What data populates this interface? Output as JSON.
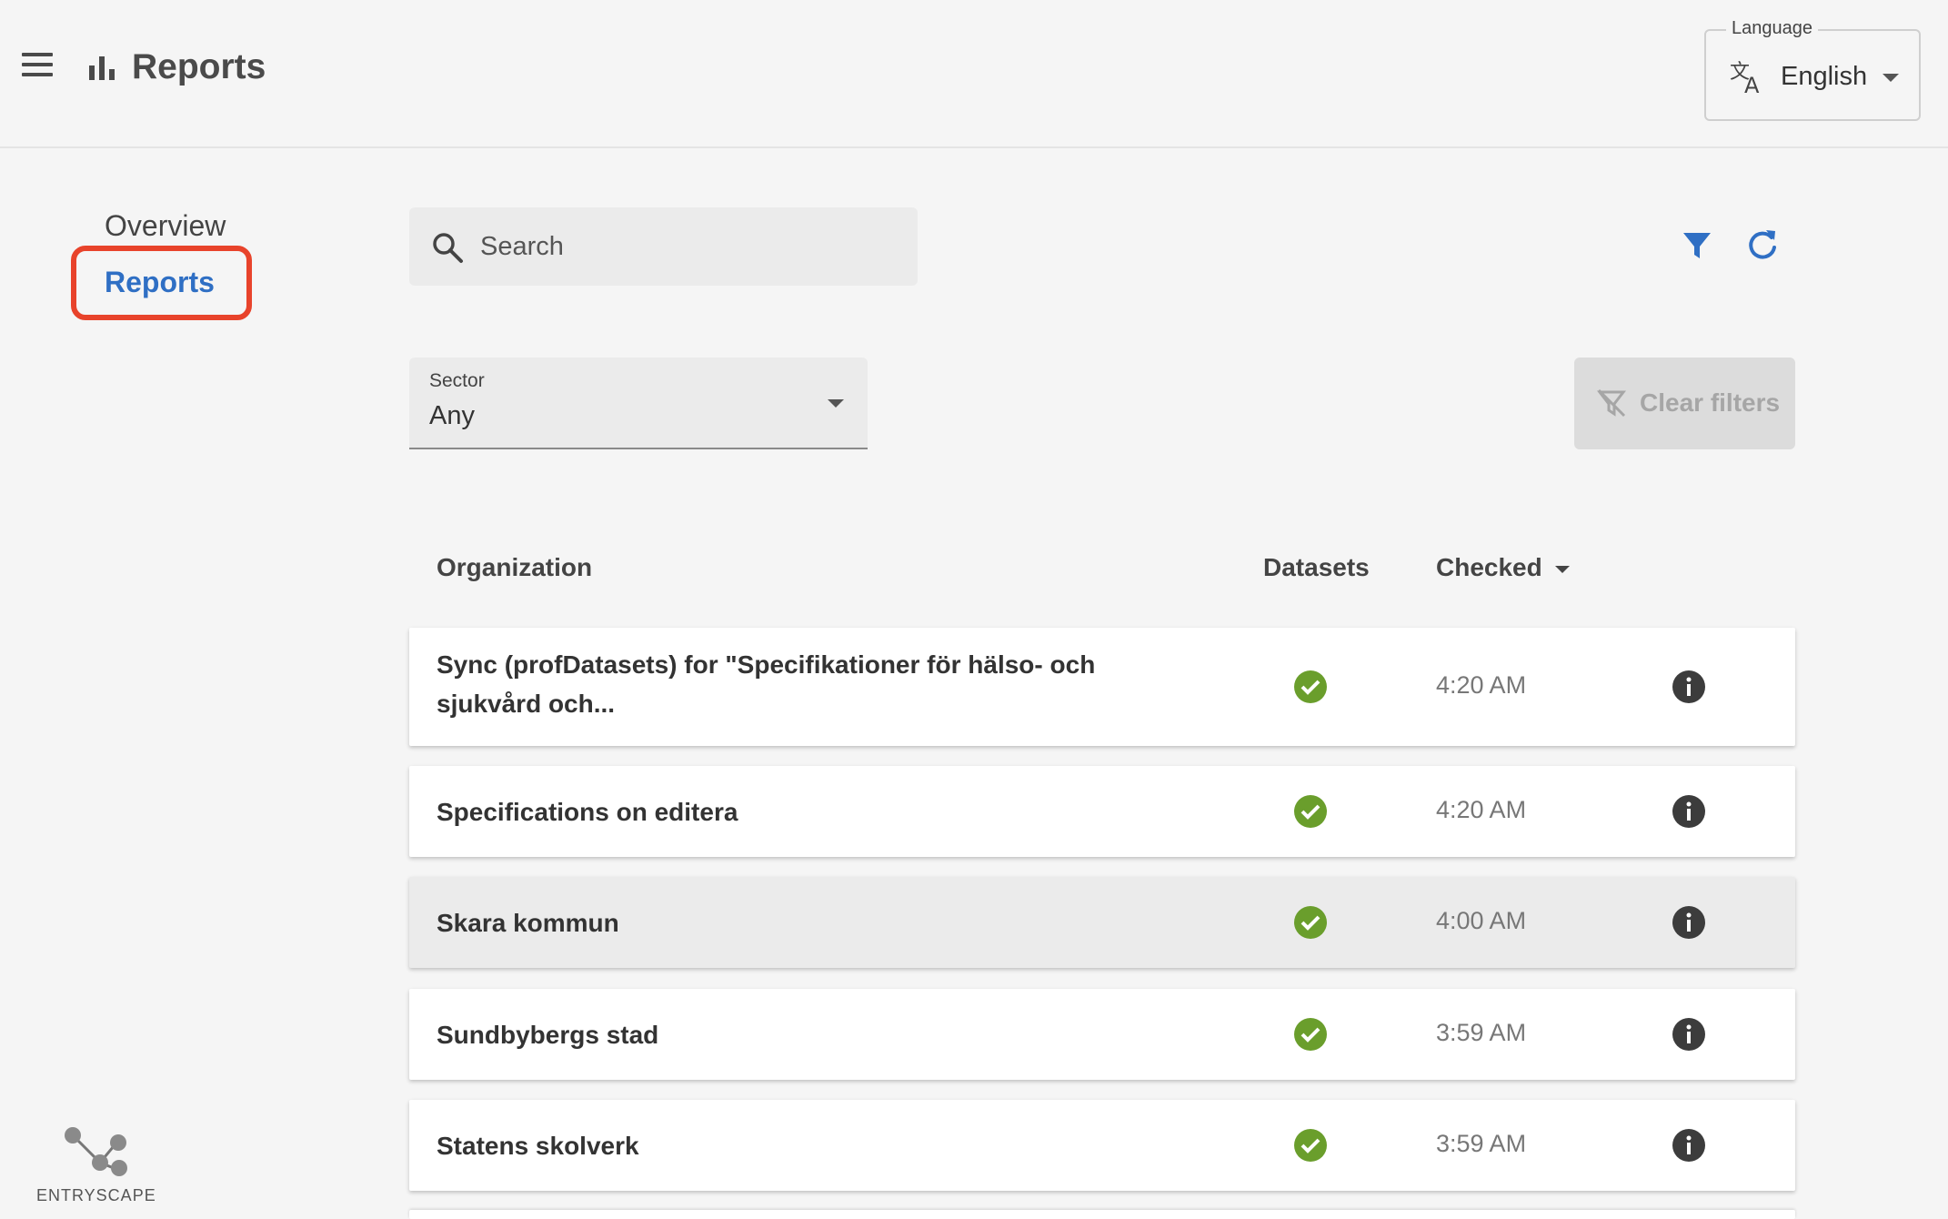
{
  "header": {
    "title": "Reports",
    "language": {
      "legend": "Language",
      "value": "English"
    }
  },
  "sidebar": {
    "items": [
      {
        "label": "Overview",
        "active": false
      },
      {
        "label": "Reports",
        "active": true
      }
    ],
    "logo_text": "ENTRYSCAPE"
  },
  "toolbar": {
    "search_placeholder": "Search",
    "filter_icon": "filter-icon",
    "refresh_icon": "refresh-icon"
  },
  "filters": {
    "sector": {
      "label": "Sector",
      "value": "Any"
    },
    "clear_label": "Clear filters"
  },
  "table": {
    "columns": {
      "organization": "Organization",
      "datasets": "Datasets",
      "checked": "Checked"
    },
    "rows": [
      {
        "name": "Sync (profDatasets) for \"Specifikationer för hälso- och sjukvård och...",
        "datasets_status": "ok",
        "checked": "4:20 AM"
      },
      {
        "name": "Specifications on editera",
        "datasets_status": "ok",
        "checked": "4:20 AM"
      },
      {
        "name": "Skara kommun",
        "datasets_status": "ok",
        "checked": "4:00 AM"
      },
      {
        "name": "Sundbybergs stad",
        "datasets_status": "ok",
        "checked": "3:59 AM"
      },
      {
        "name": "Statens skolverk",
        "datasets_status": "ok",
        "checked": "3:59 AM"
      }
    ]
  },
  "colors": {
    "accent": "#2f6fc4",
    "highlight_frame": "#e8432b",
    "success": "#6a9e2c",
    "info_icon": "#3c3c3c"
  }
}
